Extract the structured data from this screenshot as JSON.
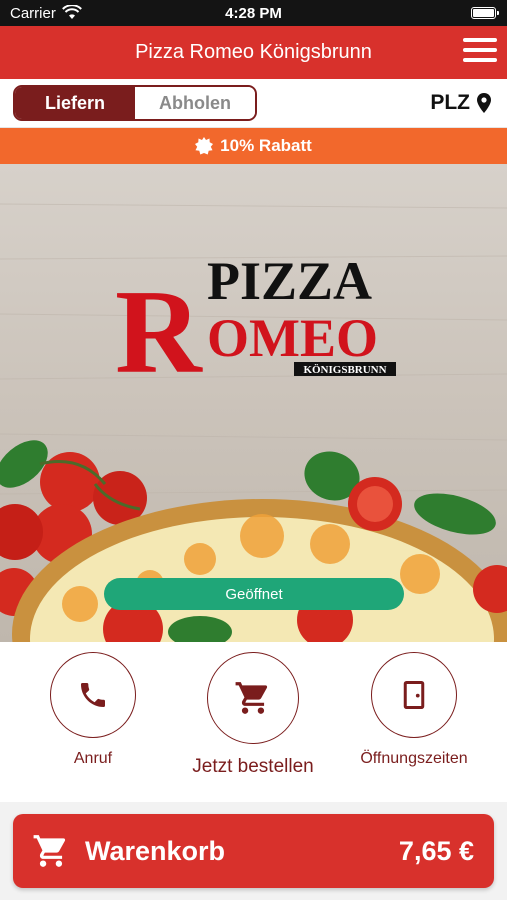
{
  "status_bar": {
    "carrier": "Carrier",
    "time": "4:28 PM"
  },
  "header": {
    "title": "Pizza Romeo Königsbrunn",
    "menu_icon": "hamburger-menu-icon"
  },
  "order_mode": {
    "options": [
      "Liefern",
      "Abholen"
    ],
    "selected": "Liefern",
    "plz_label": "PLZ",
    "plz_icon": "location-pin-icon"
  },
  "discount": {
    "text": "10% Rabatt",
    "icon": "badge-icon"
  },
  "hero": {
    "logo": {
      "line1": "PIZZA",
      "big_letter": "R",
      "line2": "OMEO",
      "sub": "KÖNIGSBRUNN"
    },
    "status": "Geöffnet"
  },
  "actions": [
    {
      "label": "Anruf",
      "icon": "phone-icon"
    },
    {
      "label": "Jetzt bestellen",
      "icon": "cart-icon"
    },
    {
      "label": "Öffnungszeiten",
      "icon": "door-icon"
    }
  ],
  "cart": {
    "label": "Warenkorb",
    "total": "7,65 €",
    "icon": "cart-icon"
  },
  "colors": {
    "brand_red": "#d8312c",
    "dark_red": "#7a1d1d",
    "banner_orange": "#f2682c",
    "open_green": "#1fa678"
  }
}
